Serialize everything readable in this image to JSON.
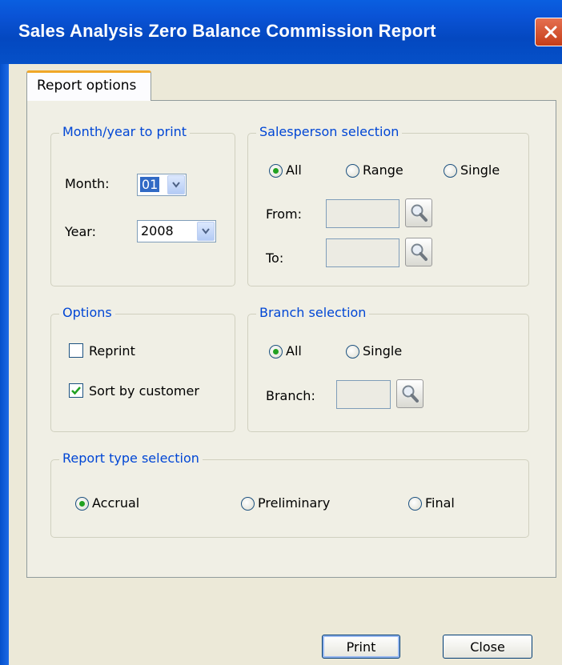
{
  "window": {
    "title": "Sales Analysis Zero Balance Commission Report"
  },
  "tab": {
    "label": "Report options"
  },
  "month_year": {
    "legend": "Month/year to print",
    "month_label": "Month:",
    "month_value": "01",
    "year_label": "Year:",
    "year_value": "2008"
  },
  "salesperson": {
    "legend": "Salesperson selection",
    "radios": {
      "all": "All",
      "range": "Range",
      "single": "Single"
    },
    "selected": "All",
    "from_label": "From:",
    "to_label": "To:"
  },
  "options": {
    "legend": "Options",
    "reprint_label": "Reprint",
    "reprint_checked": false,
    "sort_label": "Sort by customer",
    "sort_checked": true
  },
  "branch": {
    "legend": "Branch selection",
    "radios": {
      "all": "All",
      "single": "Single"
    },
    "selected": "All",
    "branch_label": "Branch:"
  },
  "report_type": {
    "legend": "Report type selection",
    "radios": {
      "accrual": "Accrual",
      "preliminary": "Preliminary",
      "final": "Final"
    },
    "selected": "Accrual"
  },
  "buttons": {
    "print": "Print",
    "close": "Close"
  },
  "colors": {
    "title_bar": "#0a53d6",
    "legend_text": "#0046d5",
    "radio_dot": "#21a121",
    "tab_highlight": "#f0a728"
  }
}
